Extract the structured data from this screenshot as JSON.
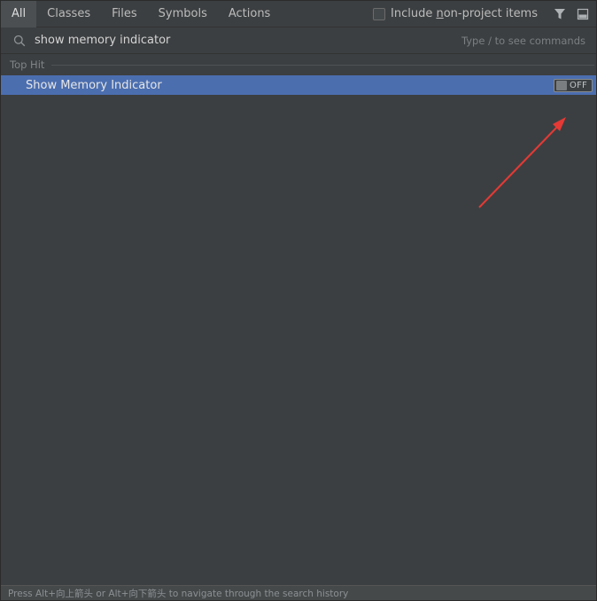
{
  "tabs": [
    {
      "label": "All",
      "active": true
    },
    {
      "label": "Classes",
      "active": false
    },
    {
      "label": "Files",
      "active": false
    },
    {
      "label": "Symbols",
      "active": false
    },
    {
      "label": "Actions",
      "active": false
    }
  ],
  "include_option": {
    "label_before": "Include ",
    "label_underlined": "n",
    "label_after": "on-project items",
    "checked": false
  },
  "icons": {
    "filter": "filter-icon",
    "preview": "preview-panel-icon",
    "search": "search-icon"
  },
  "search": {
    "value": "show memory indicator",
    "hint": "Type / to see commands"
  },
  "results": {
    "section_label": "Top Hit",
    "items": [
      {
        "label": "Show Memory Indicator",
        "toggle_text": "OFF",
        "toggle_on": false
      }
    ]
  },
  "footer": {
    "text": "Press Alt+向上箭头 or Alt+向下箭头 to navigate through the search history"
  },
  "colors": {
    "selection": "#4b6eaf",
    "annotation_arrow": "#e53935"
  }
}
